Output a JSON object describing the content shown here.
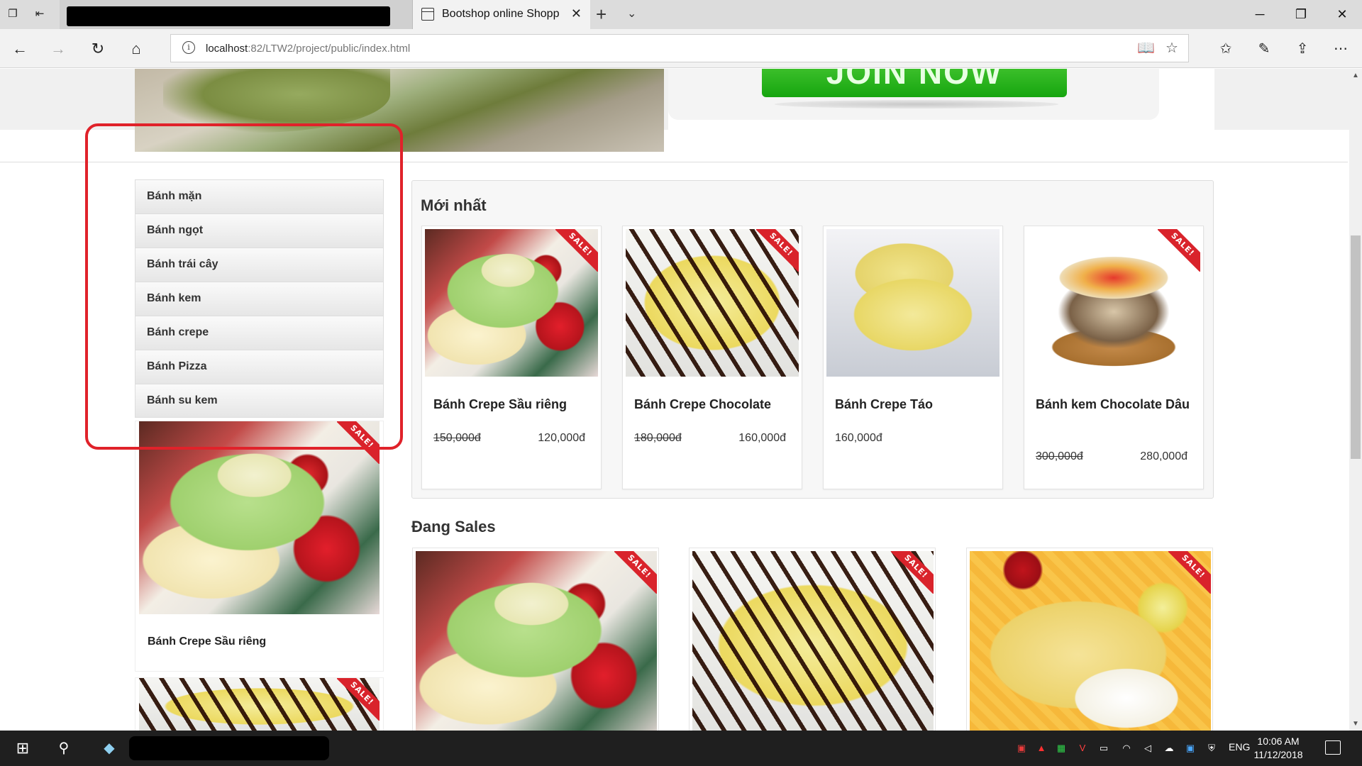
{
  "browser": {
    "inactive_tab_title": "localhost",
    "active_tab_title": "Bootshop online Shopp",
    "url_host": "localhost",
    "url_rest": ":82/LTW2/project/public/index.html"
  },
  "sidebar": {
    "items": [
      {
        "label": "Bánh mặn"
      },
      {
        "label": "Bánh ngọt"
      },
      {
        "label": "Bánh trái cây"
      },
      {
        "label": "Bánh kem"
      },
      {
        "label": "Bánh crepe"
      },
      {
        "label": "Bánh Pizza"
      },
      {
        "label": "Bánh su kem"
      }
    ],
    "featured_product": {
      "name": "Bánh Crepe Sầu riêng",
      "badge": "SALE!"
    },
    "second_product": {
      "badge": "SALE!"
    }
  },
  "newest": {
    "title": "Mới nhất",
    "products": [
      {
        "name": "Bánh Crepe Sầu riêng",
        "old_price": "150,000đ",
        "price": "120,000đ",
        "badge": "SALE!"
      },
      {
        "name": "Bánh Crepe Chocolate",
        "old_price": "180,000đ",
        "price": "160,000đ",
        "badge": "SALE!"
      },
      {
        "name": "Bánh Crepe Táo",
        "price": "160,000đ"
      },
      {
        "name": "Bánh kem Chocolate Dâu",
        "old_price": "300,000đ",
        "price": "280,000đ",
        "badge": "SALE!"
      }
    ]
  },
  "sales": {
    "title": "Đang Sales",
    "badges": [
      "SALE!",
      "SALE!",
      "SALE!"
    ]
  },
  "taskbar": {
    "lang": "ENG",
    "time": "10:06 AM",
    "date": "11/12/2018"
  },
  "colors": {
    "sale_ribbon": "#d9232b",
    "highlight": "#e0222a",
    "join_button": "#16a50f"
  }
}
